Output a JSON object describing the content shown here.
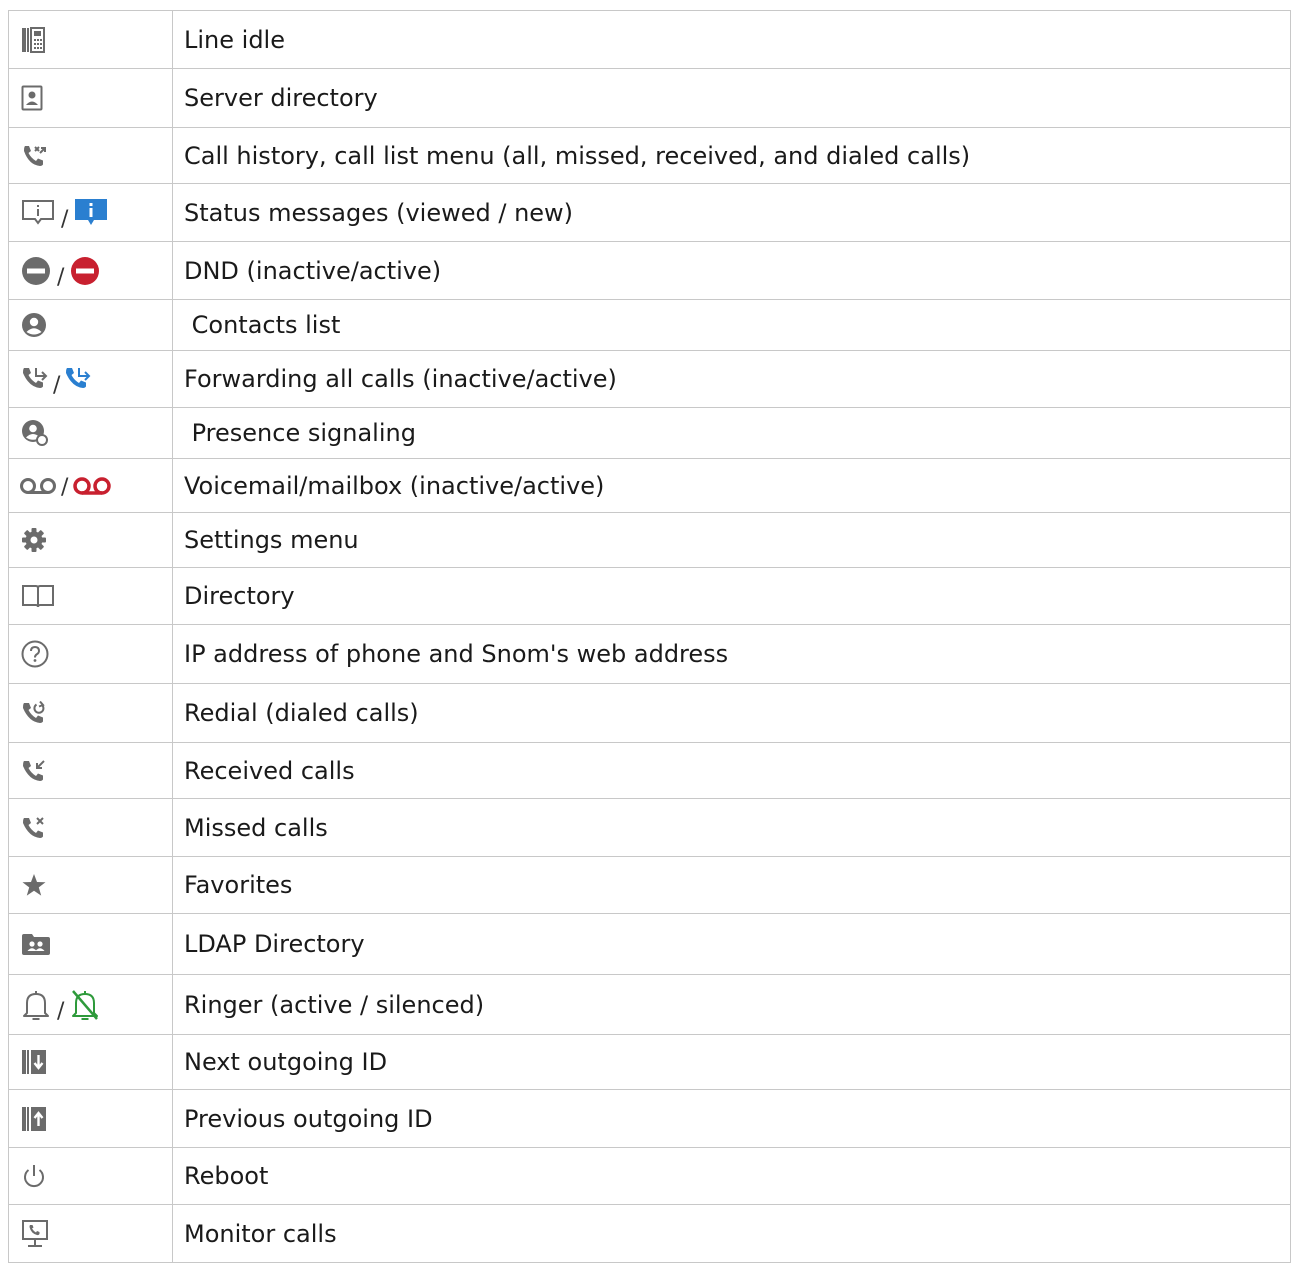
{
  "colors": {
    "icon_gray": "#6b6b6b",
    "accent_blue": "#2a7fd0",
    "dnd_red": "#c8202f",
    "voicemail_red": "#c8202f",
    "silenced_green": "#2e9a3b",
    "border": "#c8c8c8"
  },
  "separator": "/",
  "rows": [
    {
      "icons": [
        "line-idle-icon"
      ],
      "label": "Line idle"
    },
    {
      "icons": [
        "server-directory-icon"
      ],
      "label": "Server directory"
    },
    {
      "icons": [
        "call-history-icon"
      ],
      "label": "Call history, call list menu (all, missed, received, and dialed calls)"
    },
    {
      "icons": [
        "status-viewed-icon",
        "status-new-icon"
      ],
      "label": "Status messages (viewed / new)"
    },
    {
      "icons": [
        "dnd-inactive-icon",
        "dnd-active-icon"
      ],
      "label": "DND (inactive/active)"
    },
    {
      "icons": [
        "contacts-icon"
      ],
      "label": " Contacts list"
    },
    {
      "icons": [
        "forward-inactive-icon",
        "forward-active-icon"
      ],
      "label": "Forwarding all calls (inactive/active)"
    },
    {
      "icons": [
        "presence-icon"
      ],
      "label": " Presence signaling"
    },
    {
      "icons": [
        "voicemail-inactive-icon",
        "voicemail-active-icon"
      ],
      "label": "Voicemail/mailbox (inactive/active)"
    },
    {
      "icons": [
        "settings-icon"
      ],
      "label": "Settings menu"
    },
    {
      "icons": [
        "directory-book-icon"
      ],
      "label": "Directory"
    },
    {
      "icons": [
        "question-icon"
      ],
      "label": "IP address of phone and Snom's web address"
    },
    {
      "icons": [
        "redial-icon"
      ],
      "label": "Redial (dialed calls)"
    },
    {
      "icons": [
        "received-calls-icon"
      ],
      "label": "Received calls"
    },
    {
      "icons": [
        "missed-calls-icon"
      ],
      "label": "Missed calls"
    },
    {
      "icons": [
        "star-icon"
      ],
      "label": "Favorites"
    },
    {
      "icons": [
        "ldap-directory-icon"
      ],
      "label": "LDAP Directory"
    },
    {
      "icons": [
        "bell-icon",
        "bell-silenced-icon"
      ],
      "label": "Ringer (active / silenced)"
    },
    {
      "icons": [
        "next-outgoing-id-icon"
      ],
      "label": "Next outgoing ID"
    },
    {
      "icons": [
        "previous-outgoing-id-icon"
      ],
      "label": "Previous outgoing ID"
    },
    {
      "icons": [
        "power-icon"
      ],
      "label": "Reboot"
    },
    {
      "icons": [
        "monitor-calls-icon"
      ],
      "label": "Monitor calls"
    }
  ]
}
